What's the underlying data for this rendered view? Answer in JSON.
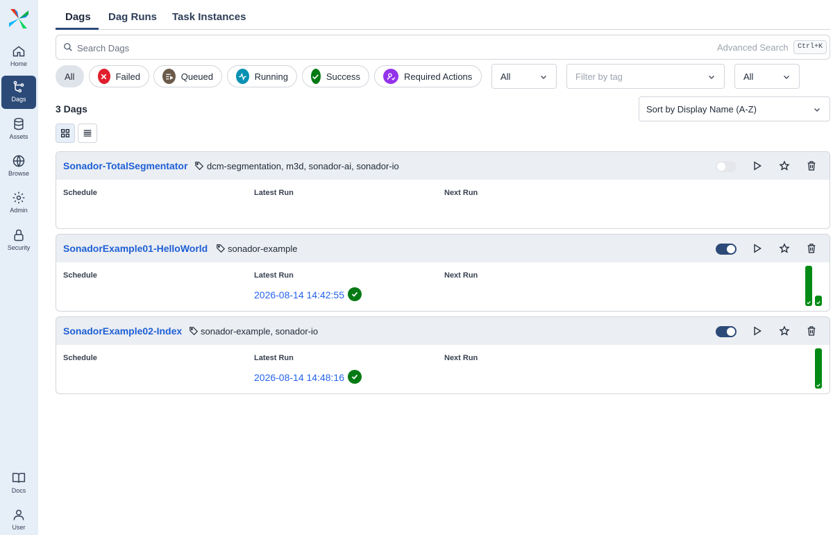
{
  "sidebar": {
    "items": [
      {
        "label": "Home",
        "icon": "home-icon"
      },
      {
        "label": "Dags",
        "icon": "dags-icon"
      },
      {
        "label": "Assets",
        "icon": "database-icon"
      },
      {
        "label": "Browse",
        "icon": "globe-icon"
      },
      {
        "label": "Admin",
        "icon": "gear-icon"
      },
      {
        "label": "Security",
        "icon": "lock-icon"
      },
      {
        "label": "Docs",
        "icon": "book-icon"
      },
      {
        "label": "User",
        "icon": "user-icon"
      }
    ],
    "active": "Dags"
  },
  "tabs": [
    {
      "label": "Dags",
      "active": true
    },
    {
      "label": "Dag Runs",
      "active": false
    },
    {
      "label": "Task Instances",
      "active": false
    }
  ],
  "search": {
    "placeholder": "Search Dags",
    "value": "",
    "advanced_label": "Advanced Search",
    "shortcut": "Ctrl+K"
  },
  "filters": {
    "states": [
      {
        "label": "All",
        "active": true
      },
      {
        "label": "Failed",
        "color": "#e11d2c",
        "icon": "x-icon"
      },
      {
        "label": "Queued",
        "color": "#6b5a4a",
        "icon": "queue-icon"
      },
      {
        "label": "Running",
        "color": "#06b6d4",
        "icon": "activity-icon"
      },
      {
        "label": "Success",
        "color": "#047a14",
        "icon": "check-icon"
      },
      {
        "label": "Required Actions",
        "color": "#9333ea",
        "icon": "user-action-icon"
      }
    ],
    "select_one": "All",
    "tag_placeholder": "Filter by tag",
    "select_two": "All"
  },
  "list": {
    "count_label": "3 Dags",
    "sort_label": "Sort by Display Name (A-Z)",
    "view_modes": [
      "grid-view-icon",
      "list-view-icon"
    ]
  },
  "columns": {
    "schedule": "Schedule",
    "latest_run": "Latest Run",
    "next_run": "Next Run"
  },
  "dags": [
    {
      "name": "Sonador-TotalSegmentator",
      "tags": "dcm-segmentation, m3d, sonador-ai, sonador-io",
      "enabled": false,
      "latest_run": "",
      "latest_state": "",
      "recent_runs": []
    },
    {
      "name": "SonadorExample01-HelloWorld",
      "tags": "sonador-example",
      "enabled": true,
      "latest_run": "2026-08-14 14:42:55",
      "latest_state": "success",
      "recent_runs": [
        {
          "state": "success",
          "duration_fraction": 1.0
        },
        {
          "state": "success",
          "duration_fraction": 0.26
        }
      ]
    },
    {
      "name": "SonadorExample02-Index",
      "tags": "sonador-example, sonador-io",
      "enabled": true,
      "latest_run": "2026-08-14 14:48:16",
      "latest_state": "success",
      "recent_runs": [
        {
          "state": "success",
          "duration_fraction": 1.0
        }
      ]
    }
  ],
  "colors": {
    "accent": "#2b4a78",
    "link": "#2563eb",
    "dag_title": "#1d5fd6",
    "success": "#047a14",
    "sidebar_bg": "#e6eef8"
  }
}
